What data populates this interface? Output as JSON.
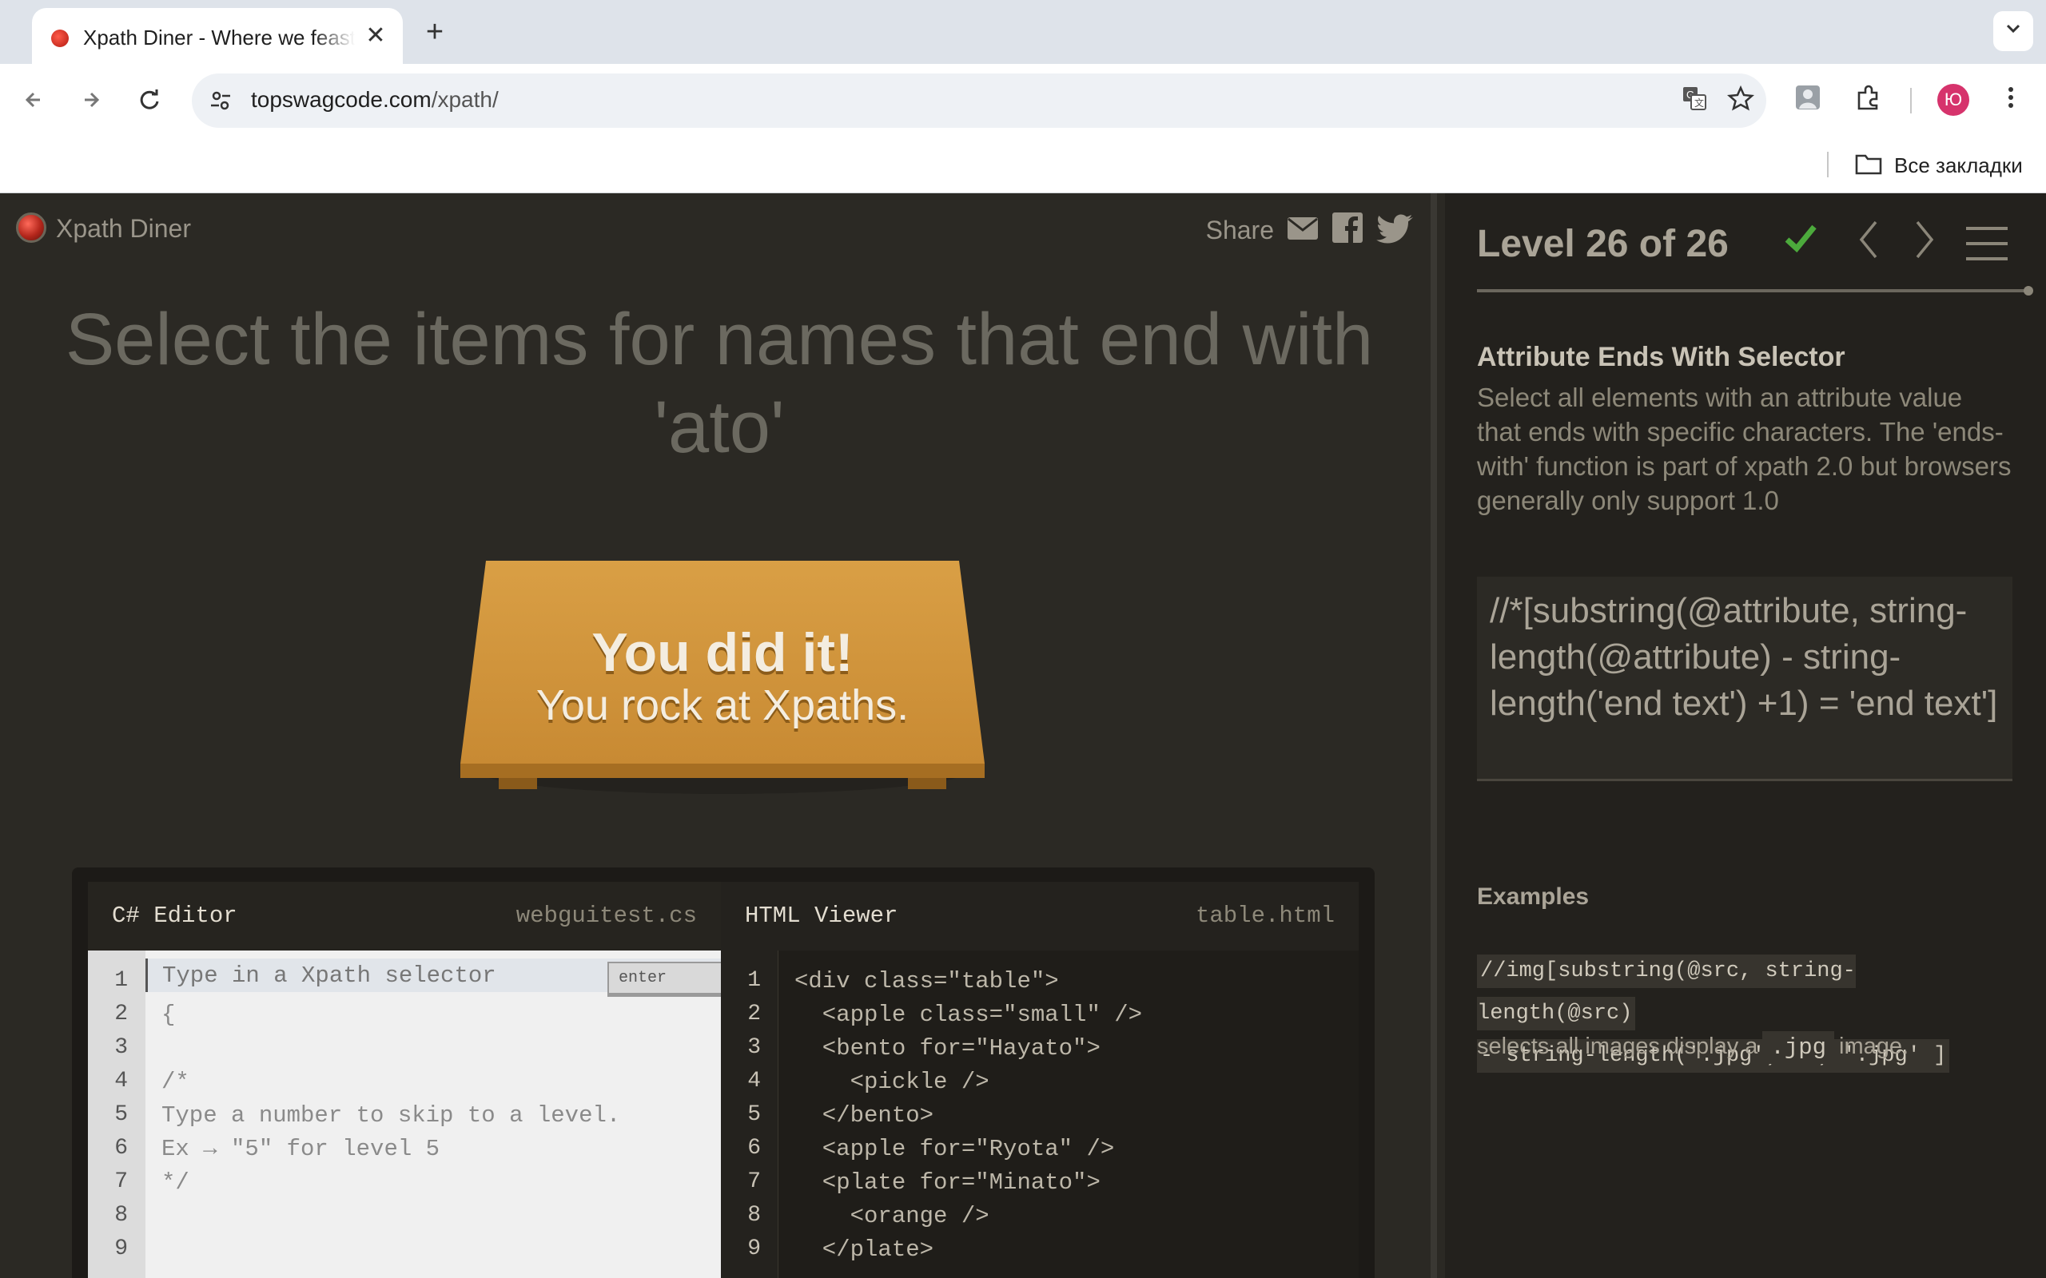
{
  "browser": {
    "tab_title": "Xpath Diner - Where we feast on XPath",
    "tab_close": "✕",
    "new_tab": "+",
    "url_host": "topswagcode.com",
    "url_path": "/xpath/",
    "bookmarks_label": "Все закладки",
    "avatar_letter": "Ю"
  },
  "header": {
    "logo_text": "Xpath Diner",
    "share_label": "Share"
  },
  "order": {
    "instruction": "Select the items for names that end with 'ato'"
  },
  "table": {
    "message_line1": "You did it!",
    "message_line2": "You rock at Xpaths."
  },
  "editor": {
    "css_title": "C# Editor",
    "css_file": "webguitest.cs",
    "html_title": "HTML Viewer",
    "html_file": "table.html",
    "input_placeholder": "Type in a Xpath selector",
    "enter_label": "enter",
    "css_line_numbers": [
      "1",
      "2",
      "3",
      "4",
      "5",
      "6",
      "7",
      "8",
      "9"
    ],
    "css_lines": [
      "",
      "{",
      "",
      "/*",
      "Type a number to skip to a level.",
      "Ex → \"5\" for level 5",
      "*/",
      "",
      ""
    ],
    "html_line_numbers": [
      "1",
      "2",
      "3",
      "4",
      "5",
      "6",
      "7",
      "8",
      "9"
    ],
    "html_lines": [
      "<div class=\"table\">",
      "  <apple class=\"small\" />",
      "  <bento for=\"Hayato\">",
      "    <pickle />",
      "  </bento>",
      "  <apple for=\"Ryota\" />",
      "  <plate for=\"Minato\">",
      "    <orange />",
      "  </plate>"
    ]
  },
  "sidebar": {
    "level_text": "Level 26 of 26",
    "level_progress": 1.0,
    "selector_name": "Attribute Ends With Selector",
    "description": "Select all elements with an attribute value that ends with specific characters. The 'ends-with' function is part of xpath 2.0 but browsers generally only support 1.0",
    "syntax": "//*[substring(@attribute, string-length(@attribute) - string-length('end text') +1) = 'end text']",
    "examples_title": "Examples",
    "example_code_line1": "//img[substring(@src, string-length(@src)",
    "example_code_line2": "- string-length('.jpg')+1 ) '.jpg' ]",
    "example_text_before": "selects all images display a",
    "example_inline_code": ".jpg",
    "example_text_after": "image."
  },
  "colors": {
    "page_bg": "#2b2924",
    "table_top": "#d49a3f",
    "check_green": "#4caa3c",
    "avatar_bg": "#d6336c"
  }
}
